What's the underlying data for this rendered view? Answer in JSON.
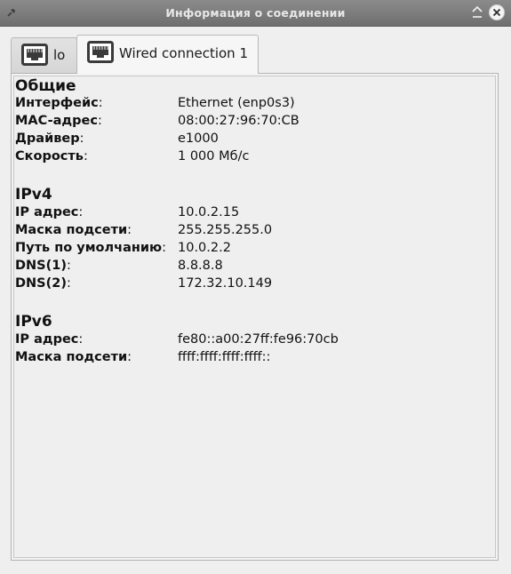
{
  "window": {
    "title": "Информация о соединении"
  },
  "tabs": [
    {
      "label": "lo",
      "icon": "ethernet-port-icon",
      "active": false
    },
    {
      "label": "Wired connection 1",
      "icon": "ethernet-port-icon",
      "active": true
    }
  ],
  "sections": {
    "general": {
      "title": "Общие",
      "rows": [
        {
          "label": "Интерфейс",
          "value": "Ethernet (enp0s3)"
        },
        {
          "label": "MAC-адрес",
          "value": "08:00:27:96:70:CB"
        },
        {
          "label": "Драйвер",
          "value": "e1000"
        },
        {
          "label": "Скорость",
          "value": "1 000 Мб/с"
        }
      ]
    },
    "ipv4": {
      "title": "IPv4",
      "rows": [
        {
          "label": "IP адрес",
          "value": "10.0.2.15"
        },
        {
          "label": "Маска подсети",
          "value": "255.255.255.0"
        },
        {
          "label": "Путь по умолчанию",
          "value": "10.0.2.2"
        },
        {
          "label": "DNS(1)",
          "value": "8.8.8.8"
        },
        {
          "label": "DNS(2)",
          "value": "172.32.10.149"
        }
      ]
    },
    "ipv6": {
      "title": "IPv6",
      "rows": [
        {
          "label": "IP адрес",
          "value": "fe80::a00:27ff:fe96:70cb"
        },
        {
          "label": "Маска подсети",
          "value": "ffff:ffff:ffff:ffff::"
        }
      ]
    }
  },
  "colon": ":"
}
